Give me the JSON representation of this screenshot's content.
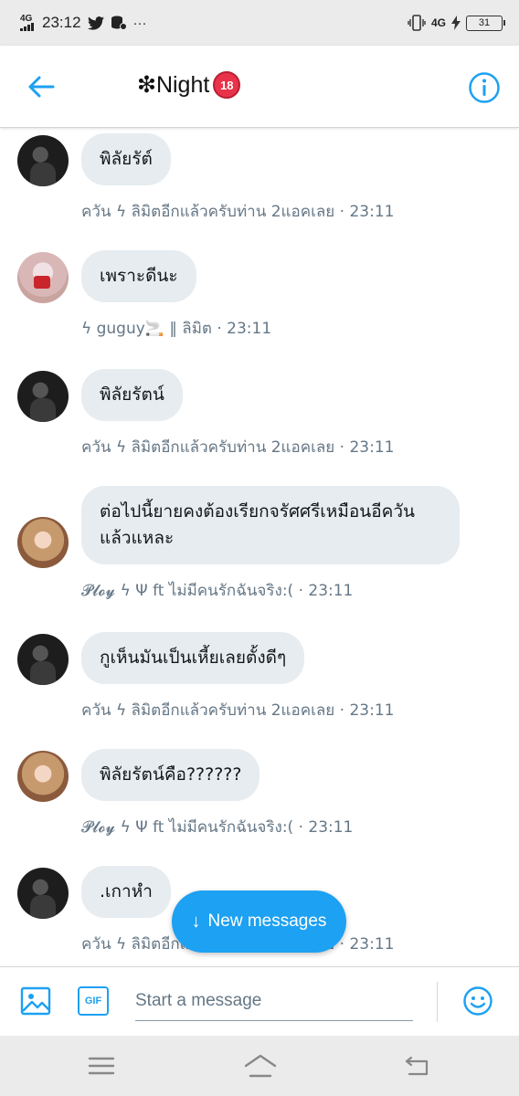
{
  "status_bar": {
    "network": "4G",
    "time": "23:12",
    "twitter_icon": "twitter-bird-icon",
    "more": "···",
    "right_network": "4G",
    "battery": "31"
  },
  "header": {
    "title": "❇Night",
    "badge": "18"
  },
  "messages": [
    {
      "avatar": "dark",
      "text": "พิลัยรัต์",
      "meta": "ควัน ϟ ลิมิตอีกแล้วครับท่าน 2แอคเลย · 23:11"
    },
    {
      "avatar": "pink",
      "text": "เพราะดีนะ",
      "meta": "ϟ guguy🚬 ‖ ลิมิต · 23:11"
    },
    {
      "avatar": "dark",
      "text": "พิลัยรัตน์",
      "meta": "ควัน ϟ ลิมิตอีกแล้วครับท่าน 2แอคเลย · 23:11"
    },
    {
      "avatar": "girl",
      "text": "ต่อไปนี้ยายคงต้องเรียกจรัศศรีเหมือนอีควันแล้วแหละ",
      "meta": "𝓟𝓵𝓸𝔂 ϟ Ψ ft ไม่มีคนรักฉันจริง:( · 23:11"
    },
    {
      "avatar": "dark",
      "text": "กูเห็นมันเป็นเหี้ยเลยตั้งดีๆ",
      "meta": "ควัน ϟ ลิมิตอีกแล้วครับท่าน 2แอคเลย · 23:11"
    },
    {
      "avatar": "girl",
      "text": "พิลัยรัตน์คือ??????",
      "meta": "𝓟𝓵𝓸𝔂 ϟ Ψ ft ไม่มีคนรักฉันจริง:( · 23:11"
    },
    {
      "avatar": "dark",
      "text": ".เกาหำ",
      "meta": "ควัน ϟ ลิมิตอีกแล้วครับท่าน 2แอคเลย · 23:11"
    }
  ],
  "new_messages": {
    "label": "New messages"
  },
  "composer": {
    "gif_label": "GIF",
    "placeholder": "Start a message"
  },
  "colors": {
    "accent": "#1da1f2",
    "bubble": "#e6ecf0",
    "meta": "#657786"
  }
}
